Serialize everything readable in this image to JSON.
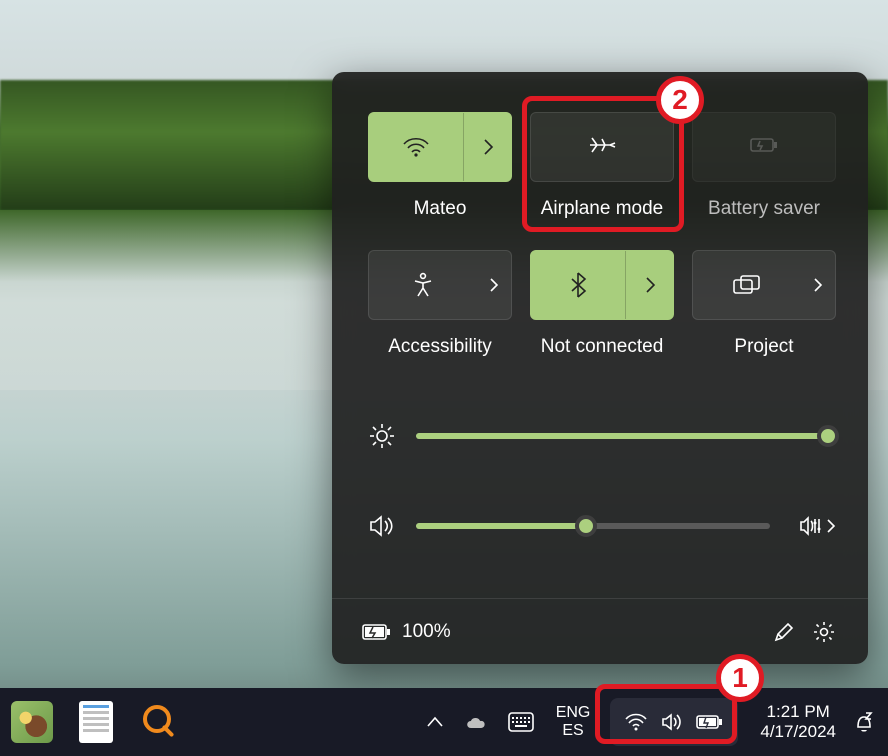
{
  "quick_settings": {
    "tiles": [
      {
        "id": "wifi",
        "label": "Mateo",
        "active": true,
        "has_expand": true,
        "icon": "wifi-icon"
      },
      {
        "id": "airplane",
        "label": "Airplane mode",
        "active": false,
        "has_expand": false,
        "icon": "airplane-icon"
      },
      {
        "id": "battery_saver",
        "label": "Battery saver",
        "active": false,
        "has_expand": false,
        "icon": "battery-saver-icon",
        "disabled": true
      },
      {
        "id": "accessibility",
        "label": "Accessibility",
        "active": false,
        "has_expand": true,
        "icon": "accessibility-icon"
      },
      {
        "id": "bluetooth",
        "label": "Not connected",
        "active": true,
        "has_expand": true,
        "icon": "bluetooth-icon"
      },
      {
        "id": "project",
        "label": "Project",
        "active": false,
        "has_expand": true,
        "icon": "project-icon"
      }
    ],
    "brightness": {
      "percent": 98
    },
    "volume": {
      "percent": 48
    },
    "battery_status_text": "100%"
  },
  "taskbar": {
    "language_top": "ENG",
    "language_bottom": "ES",
    "time": "1:21 PM",
    "date": "4/17/2024"
  },
  "annotations": {
    "callout1_label": "1",
    "callout2_label": "2"
  },
  "colors": {
    "accent": "#a8ce7d",
    "annotation": "#e01b24",
    "panel_bg": "rgba(32,32,32,0.92)",
    "taskbar_bg": "#181a26"
  }
}
